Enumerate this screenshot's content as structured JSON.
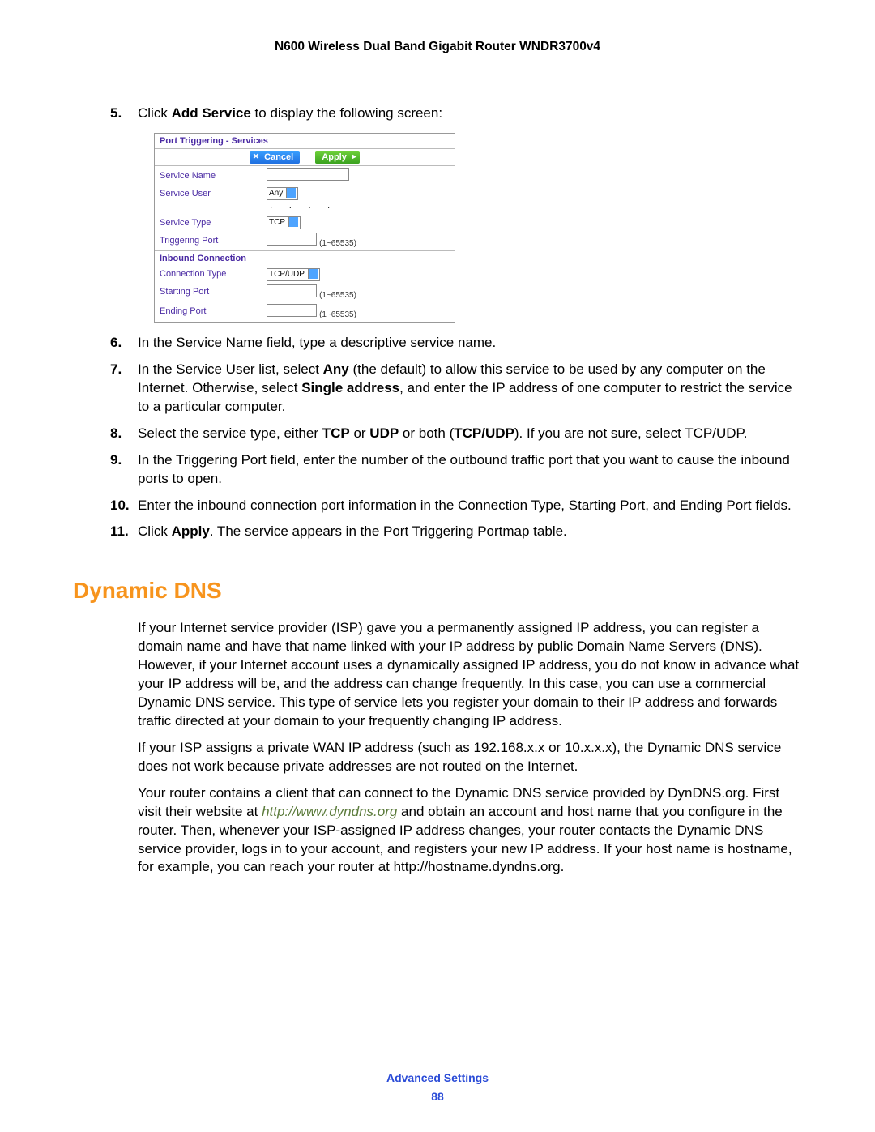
{
  "header": {
    "title": "N600 Wireless Dual Band Gigabit Router WNDR3700v4"
  },
  "ui": {
    "title": "Port Triggering - Services",
    "cancel": "Cancel",
    "apply": "Apply",
    "fields": {
      "service_name": "Service Name",
      "service_user": "Service User",
      "service_user_value": "Any",
      "service_type": "Service Type",
      "service_type_value": "TCP",
      "triggering_port": "Triggering Port",
      "triggering_hint": "(1~65535)",
      "inbound_header": "Inbound Connection",
      "connection_type": "Connection Type",
      "connection_type_value": "TCP/UDP",
      "starting_port": "Starting Port",
      "starting_hint": "(1~65535)",
      "ending_port": "Ending Port",
      "ending_hint": "(1~65535)"
    }
  },
  "steps": {
    "s5_a": "Click ",
    "s5_b": "Add Service",
    "s5_c": " to display the following screen:",
    "s6": "In the Service Name field, type a descriptive service name.",
    "s7_a": "In the Service User list, select ",
    "s7_b": "Any",
    "s7_c": " (the default) to allow this service to be used by any computer on the Internet. Otherwise, select ",
    "s7_d": "Single address",
    "s7_e": ", and enter the IP address of one computer to restrict the service to a particular computer.",
    "s8_a": "Select the service type, either ",
    "s8_b": "TCP",
    "s8_c": " or ",
    "s8_d": "UDP",
    "s8_e": " or both (",
    "s8_f": "TCP/UDP",
    "s8_g": "). If you are not sure, select TCP/UDP.",
    "s9": "In the Triggering Port field, enter the number of the outbound traffic port that you want to cause the inbound ports to open.",
    "s10": "Enter the inbound connection port information in the Connection Type, Starting Port, and Ending Port fields.",
    "s11_a": "Click ",
    "s11_b": "Apply",
    "s11_c": ". The service appears in the Port Triggering Portmap table."
  },
  "section": {
    "title": "Dynamic DNS"
  },
  "paras": {
    "p1": "If your Internet service provider (ISP) gave you a permanently assigned IP address, you can register a domain name and have that name linked with your IP address by public Domain Name Servers (DNS). However, if your Internet account uses a dynamically assigned IP address, you do not know in advance what your IP address will be, and the address can change frequently. In this case, you can use a commercial Dynamic DNS service. This type of service lets you register your domain to their IP address and forwards traffic directed at your domain to your frequently changing IP address.",
    "p2": "If your ISP assigns a private WAN IP address (such as 192.168.x.x or 10.x.x.x), the Dynamic DNS service does not work because private addresses are not routed on the Internet.",
    "p3_a": "Your router contains a client that can connect to the Dynamic DNS service provided by DynDNS.org. First visit their website at ",
    "p3_link": "http://www.dyndns.org",
    "p3_b": " and obtain an account and host name that you configure in the router. Then, whenever your ISP-assigned IP address changes, your router contacts the Dynamic DNS service provider, logs in to your account, and registers your new IP address. If your host name is hostname, for example, you can reach your router at http://hostname.dyndns.org."
  },
  "footer": {
    "title": "Advanced Settings",
    "page": "88"
  }
}
